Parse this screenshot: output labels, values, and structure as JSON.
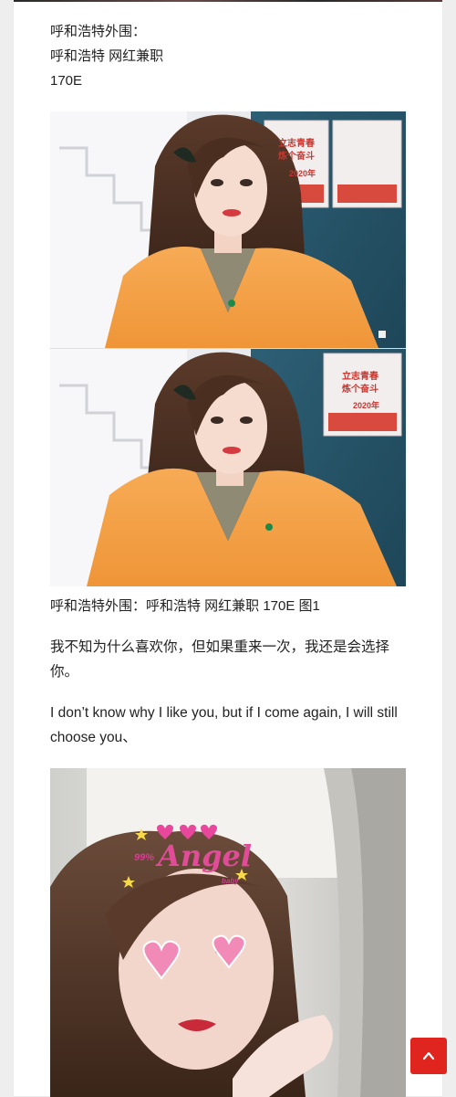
{
  "post": {
    "location_line": "呼和浩特外围：",
    "tag_line": "呼和浩特 网红兼职",
    "price_line": "170E",
    "photo_caption": "呼和浩特外围：呼和浩特 网红兼职 170E 图1",
    "paragraph_cn": "我不知为什么喜欢你，但如果重来一次，我还是会选择你。",
    "paragraph_en": "I don’t know why I like you, but if I come again, I will still choose you、"
  },
  "photo1": {
    "poster_year": "2020年",
    "poster_text_1": "立志青春",
    "poster_text_2": "炼个奋斗"
  },
  "photo2": {
    "sticker_title": "Angel",
    "sticker_prefix": "99%",
    "sticker_small": "baby"
  },
  "controls": {
    "scroll_top_icon": "chevron-up-icon"
  },
  "colors": {
    "accent": "#e0241e",
    "jacket": "#f5a04a"
  }
}
